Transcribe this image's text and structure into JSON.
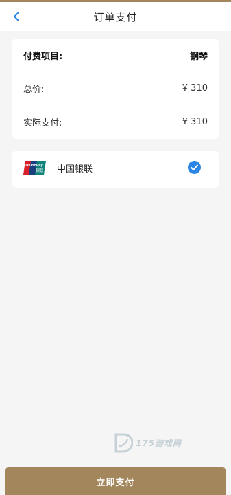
{
  "header": {
    "title": "订单支付"
  },
  "order": {
    "item_label": "付费项目:",
    "item_value": "钢琴",
    "total_label": "总价:",
    "total_value": "¥ 310",
    "actual_label": "实际支付:",
    "actual_value": "¥ 310"
  },
  "payment": {
    "method_label": "中国银联",
    "logo_line1": "UnionPay",
    "logo_line2": "银联",
    "selected": true
  },
  "watermark": {
    "text": "175游戏网"
  },
  "footer": {
    "pay_button": "立即支付"
  },
  "colors": {
    "accent": "#a3865c",
    "check": "#2b85e4",
    "back_arrow": "#2b85e4"
  },
  "icons": {
    "back": "chevron-left-icon",
    "check": "check-circle-icon",
    "logo": "unionpay-logo-icon"
  }
}
